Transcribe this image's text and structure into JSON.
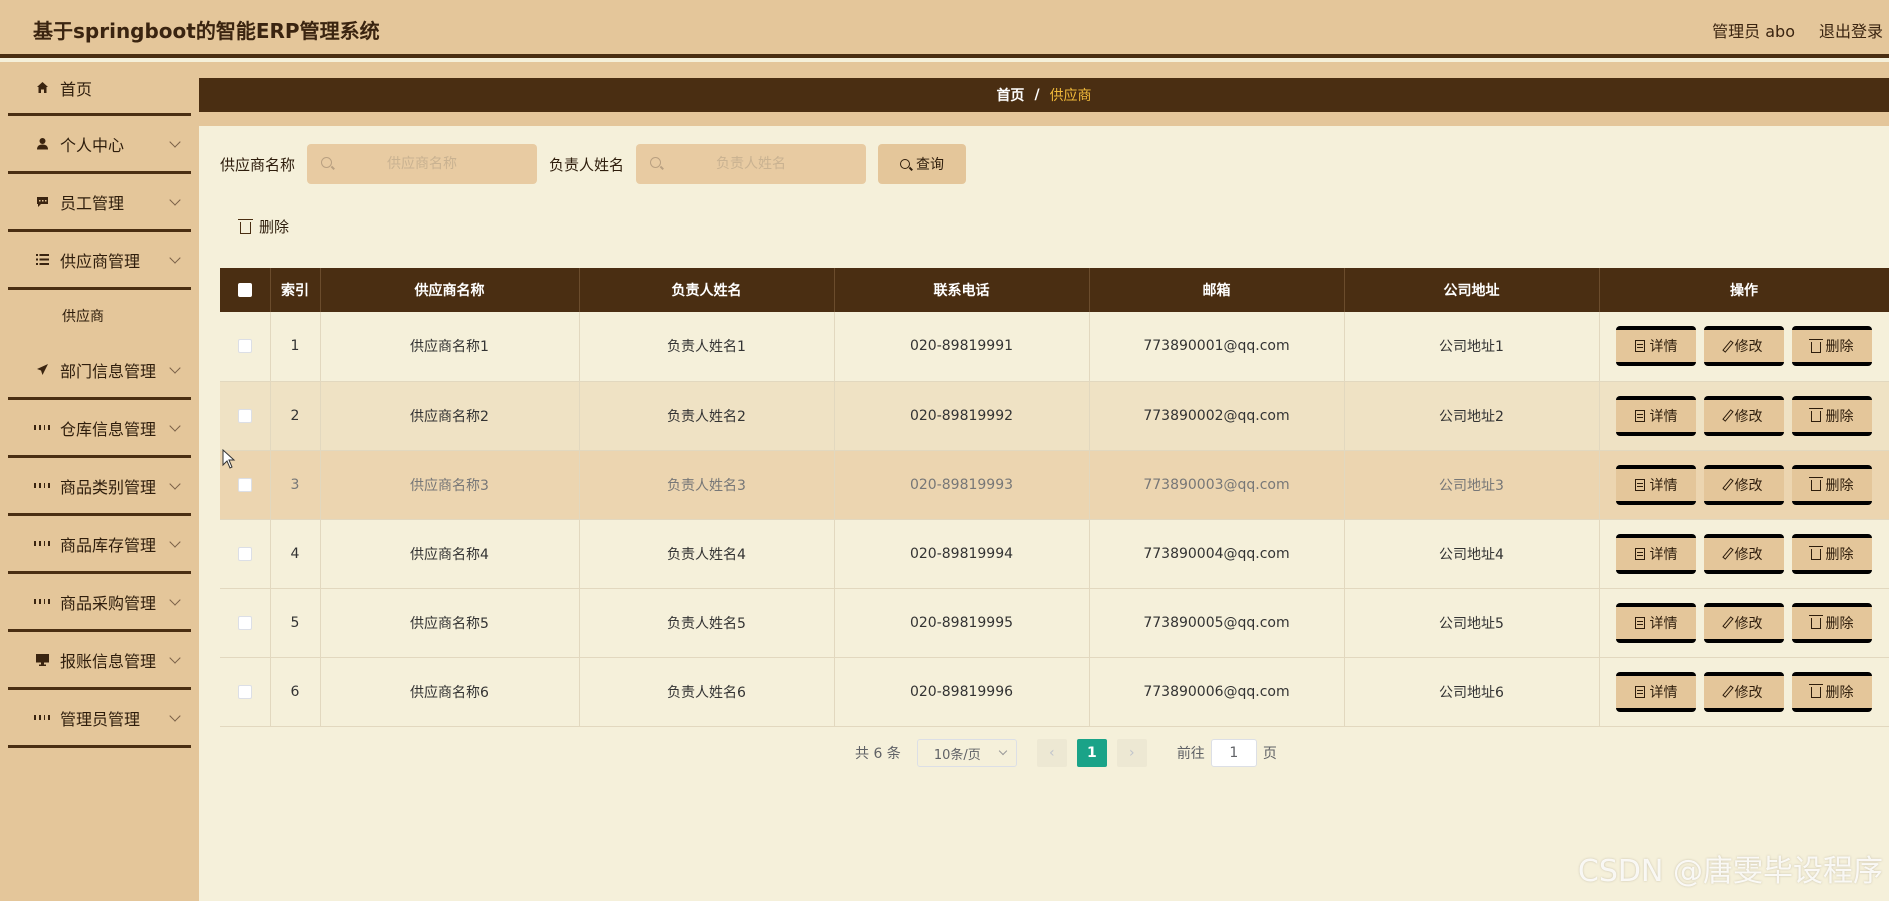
{
  "app": {
    "title": "基于springboot的智能ERP管理系统"
  },
  "header": {
    "user_label": "管理员 abo",
    "logout_label": "退出登录"
  },
  "sidebar": {
    "items": [
      {
        "label": "首页",
        "icon": "home-icon"
      },
      {
        "label": "个人中心",
        "icon": "user-icon"
      },
      {
        "label": "员工管理",
        "icon": "chat-icon"
      },
      {
        "label": "供应商管理",
        "icon": "list-icon",
        "children": [
          "供应商"
        ]
      },
      {
        "label": "部门信息管理",
        "icon": "send-icon"
      },
      {
        "label": "仓库信息管理",
        "icon": "grid-icon"
      },
      {
        "label": "商品类别管理",
        "icon": "grid-icon"
      },
      {
        "label": "商品库存管理",
        "icon": "grid-icon"
      },
      {
        "label": "商品采购管理",
        "icon": "grid-icon"
      },
      {
        "label": "报账信息管理",
        "icon": "monitor-icon"
      },
      {
        "label": "管理员管理",
        "icon": "grid-icon"
      }
    ]
  },
  "breadcrumb": {
    "home": "首页",
    "separator": "/",
    "current": "供应商"
  },
  "search": {
    "field1_label": "供应商名称",
    "field1_placeholder": "供应商名称",
    "field1_value": "",
    "field2_label": "负责人姓名",
    "field2_placeholder": "负责人姓名",
    "field2_value": "",
    "query_label": "查询"
  },
  "toolbar": {
    "delete_label": "删除"
  },
  "table": {
    "columns": [
      "索引",
      "供应商名称",
      "负责人姓名",
      "联系电话",
      "邮箱",
      "公司地址",
      "操作"
    ],
    "rows": [
      {
        "index": "1",
        "name": "供应商名称1",
        "contact": "负责人姓名1",
        "phone": "020-89819991",
        "email": "773890001@qq.com",
        "address": "公司地址1"
      },
      {
        "index": "2",
        "name": "供应商名称2",
        "contact": "负责人姓名2",
        "phone": "020-89819992",
        "email": "773890002@qq.com",
        "address": "公司地址2"
      },
      {
        "index": "3",
        "name": "供应商名称3",
        "contact": "负责人姓名3",
        "phone": "020-89819993",
        "email": "773890003@qq.com",
        "address": "公司地址3"
      },
      {
        "index": "4",
        "name": "供应商名称4",
        "contact": "负责人姓名4",
        "phone": "020-89819994",
        "email": "773890004@qq.com",
        "address": "公司地址4"
      },
      {
        "index": "5",
        "name": "供应商名称5",
        "contact": "负责人姓名5",
        "phone": "020-89819995",
        "email": "773890005@qq.com",
        "address": "公司地址5"
      },
      {
        "index": "6",
        "name": "供应商名称6",
        "contact": "负责人姓名6",
        "phone": "020-89819996",
        "email": "773890006@qq.com",
        "address": "公司地址6"
      }
    ],
    "actions": {
      "detail": "详情",
      "edit": "修改",
      "delete": "删除"
    }
  },
  "pagination": {
    "total_text": "共 6 条",
    "page_size": "10条/页",
    "current_page": "1",
    "goto_prefix": "前往",
    "goto_value": "1",
    "goto_suffix": "页",
    "prev_symbol": "‹",
    "next_symbol": "›"
  },
  "watermark": "CSDN @唐雯毕设程序",
  "colors": {
    "header_bg": "#e4c69a",
    "dark_brown": "#4a2e12",
    "page_bg": "#f5f0da",
    "accent_gold": "#f0b93a",
    "pager_active": "#1aa388"
  }
}
